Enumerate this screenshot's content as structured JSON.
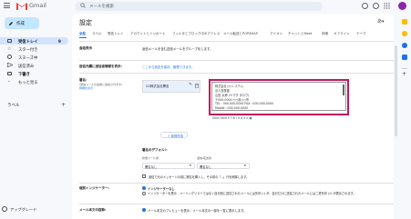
{
  "topbar": {
    "app_name": "Gmail",
    "search_placeholder": "メールを検索"
  },
  "sidebar": {
    "compose_label": "作成",
    "items": [
      {
        "label": "受信トレイ",
        "count": "9"
      },
      {
        "label": "スター付き"
      },
      {
        "label": "スヌーズ中"
      },
      {
        "label": "送信済み"
      },
      {
        "label": "下書き"
      },
      {
        "label": "もっと見る"
      }
    ],
    "labels_title": "ラベル",
    "upgrade_label": "アップグレード"
  },
  "settings": {
    "title": "設定",
    "tabs": [
      "全般",
      "ラベル",
      "受信トレイ",
      "アカウントとインポート",
      "フィルタとブロック中のアドレス",
      "メール転送とPOP/IMAP",
      "アドオン",
      "チャットとMeet",
      "詳細",
      "オフライン",
      "テーマ"
    ],
    "row1_label": "会話表示",
    "row1_text": "返信メールを含む送信メールをグループ化します。",
    "row2_label": "送信元欄に送信者情報を表示:",
    "row2_text": "ここから設定を保存、管理できます。",
    "signature": {
      "label": "署名:",
      "sub": "(送信メールの最後に追加されます)",
      "sub_link": "詳細を表示",
      "list_item": "CO株式会社署名",
      "lines": [
        "株式会社○○システム",
        "法人営業部",
        "山田 太郎 (ヤマダ タロウ)",
        "〒000-0000 ○○県○○市",
        "TEL : 000-000-0000 FAX : 000-000-0000",
        "Mobile : 000-000-0000"
      ],
      "toolbar": "Sans Serif ▾  T  B  I  U  A ▾  ⇔  ▣",
      "new_button": "+ 新規作成"
    },
    "defaults_title": "署名のデフォルト",
    "defaults": {
      "new_label": "新規メール用",
      "reply_label": "返信/転送用",
      "new_value": "署名なし",
      "reply_value": "署名なし"
    },
    "insert_checkbox_label": "返信で元のメッセージの前に署名を挿入し、その前の「--」行を削除します。",
    "personal_indicator": {
      "label": "個別インジケーター:",
      "opt1": "インジケーターなし",
      "opt2": "インジケーターを表示 - メーリングリストではなく自分宛に送信されたメールには矢印 (›) が、自分だけに送信されたメールには二重矢印 (») が表示されます。"
    },
    "snippets": {
      "label": "メール本文の抜粋:",
      "text": "メール本文のプレビューを表示 - メール本文の一部を一覧に表示します。"
    }
  },
  "colors": {
    "accent": "#1a73e8",
    "highlight": "#c2185b",
    "compose_bg": "#c2e7ff"
  }
}
